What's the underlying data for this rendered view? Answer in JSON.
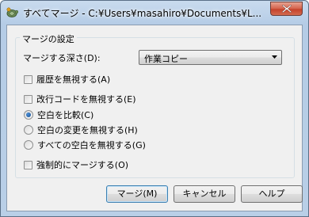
{
  "window": {
    "title": "すべてマージ - C:¥Users¥masahiro¥Documents¥L..."
  },
  "settings": {
    "group_label": "マージの設定",
    "depth_label": "マージする深さ(D):",
    "depth_value": "作業コピー",
    "ignore_history_label": "履歴を無視する(A)",
    "ignore_eol_label": "改行コードを無視する(E)",
    "compare_whitespace_label": "空白を比較(C)",
    "ignore_whitespace_changes_label": "空白の変更を無視する(H)",
    "ignore_all_whitespace_label": "すべての空白を無視する(G)",
    "force_merge_label": "強制的にマージする(O)"
  },
  "buttons": {
    "merge": "マージ(M)",
    "cancel": "キャンセル",
    "help": "ヘルプ"
  },
  "state": {
    "ignore_history": false,
    "ignore_eol": false,
    "whitespace_option": "compare",
    "force_merge": false
  }
}
